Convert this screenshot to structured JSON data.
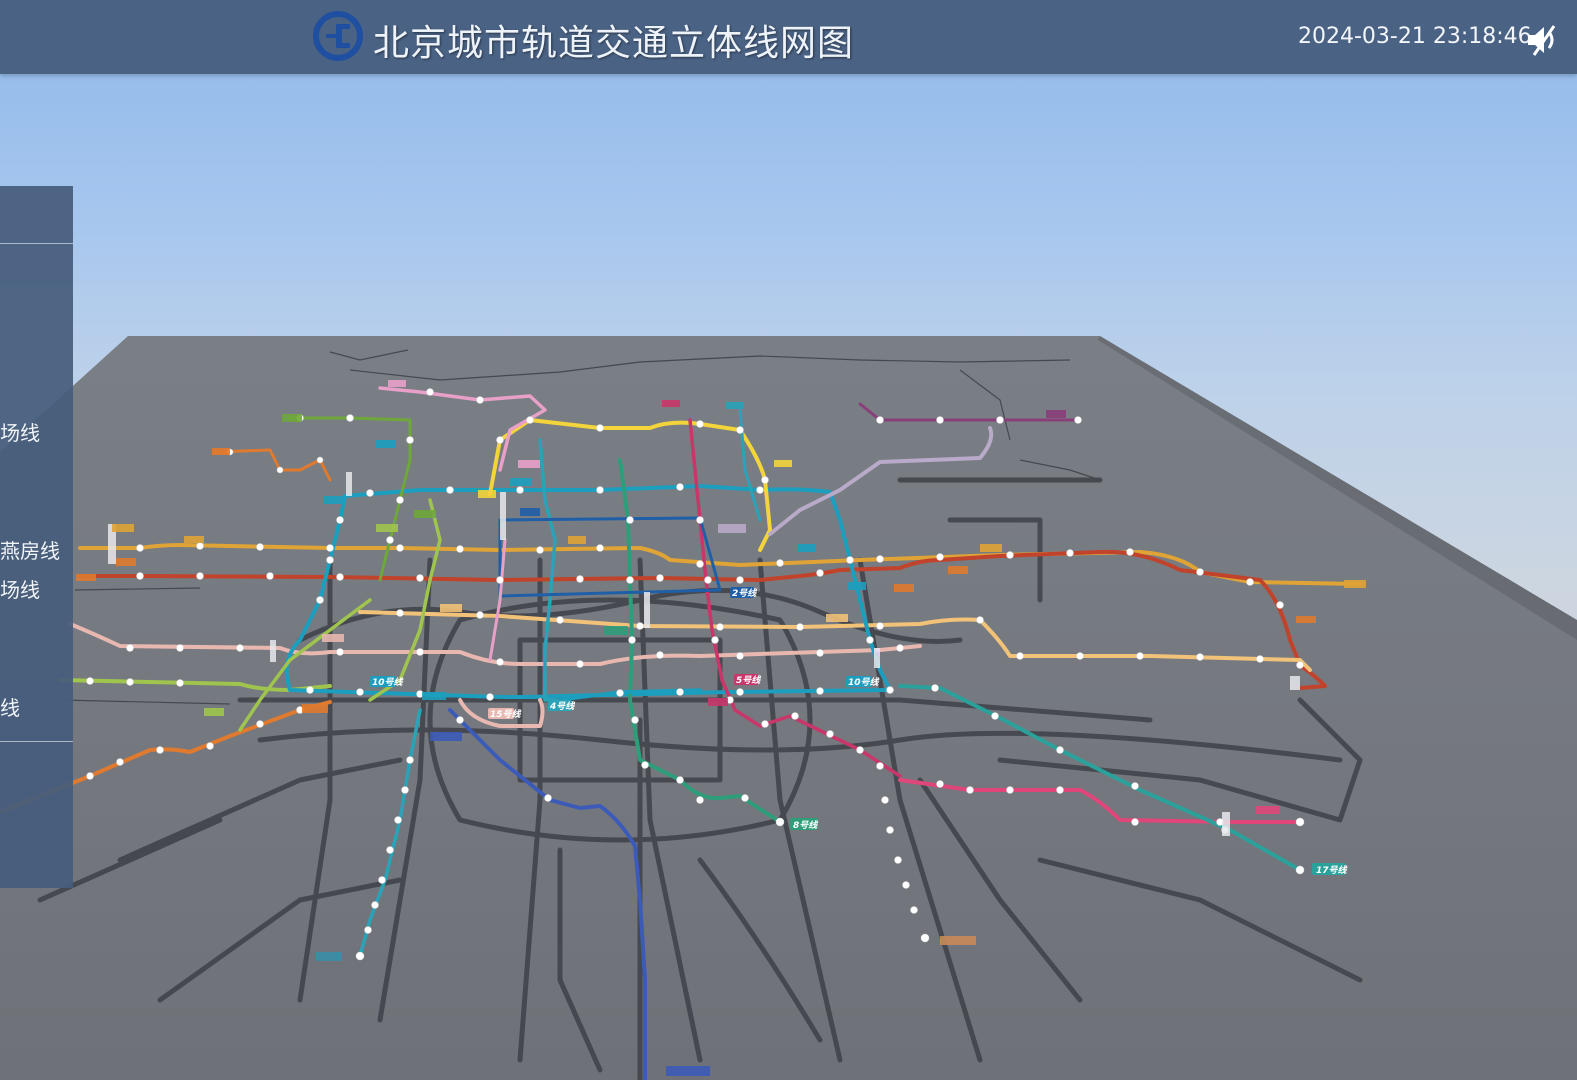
{
  "header": {
    "title": "北京城市轨道交通立体线网图",
    "datetime": "2024-03-21 23:18:46",
    "logo_icon": "beijing-subway-logo-icon",
    "mute_icon": "speaker-muted-icon"
  },
  "sidebar": {
    "items": [
      {
        "label": "场线"
      },
      {
        "label": "燕房线"
      },
      {
        "label": "场线"
      },
      {
        "label": "线"
      }
    ]
  },
  "map": {
    "line_labels": [
      {
        "text": "17号线"
      },
      {
        "text": "8号线"
      },
      {
        "text": "10号线"
      },
      {
        "text": "10号线"
      },
      {
        "text": "4号线"
      },
      {
        "text": "5号线"
      },
      {
        "text": "2号线"
      },
      {
        "text": "15号线"
      }
    ],
    "colors": {
      "line1": "#c2432b",
      "line2": "#1f5fa8",
      "line4": "#2aa3b8",
      "line5": "#c8366a",
      "line6": "#e0a336",
      "line7": "#f2c279",
      "line8": "#2e9e7a",
      "line9": "#9fc54e",
      "line10": "#1c9fbe",
      "line13": "#f3d43a",
      "line14": "#e8b8b0",
      "line15": "#8b3f7a",
      "line16": "#6fa83a",
      "line17": "#2aa19a",
      "fangshan": "#e07a2e",
      "daxing_airport": "#3c5bb8",
      "yizhuang": "#e0467a",
      "airport_express": "#b8aac8",
      "batong": "#c2432b",
      "changping": "#e8a0c8"
    }
  }
}
